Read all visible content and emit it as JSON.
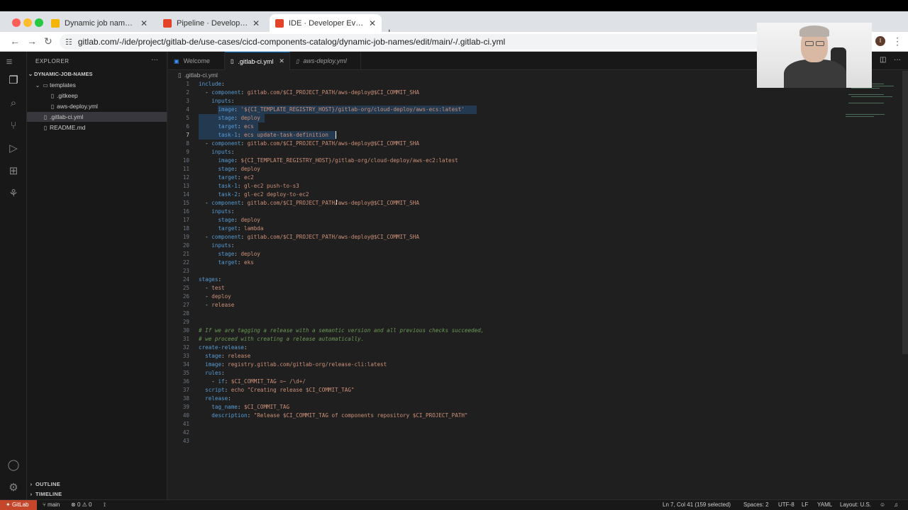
{
  "browser": {
    "tabs": [
      {
        "title": "Dynamic job names - Google",
        "active": false,
        "favicon_color": "#f4b400"
      },
      {
        "title": "Pipeline · Developer Evangeli",
        "active": false,
        "favicon_color": "#e24329"
      },
      {
        "title": "IDE · Developer Evangelism a",
        "active": true,
        "favicon_color": "#e24329"
      }
    ],
    "new_tab": "+",
    "url": "gitlab.com/-/ide/project/gitlab-de/use-cases/cicd-components-catalog/dynamic-job-names/edit/main/-/.gitlab-ci.yml",
    "profile_initial": "I"
  },
  "sidebar": {
    "header": "EXPLORER",
    "root": "DYNAMIC-JOB-NAMES",
    "items": [
      {
        "label": "templates",
        "type": "folder"
      },
      {
        "label": ".gitkeep",
        "type": "file"
      },
      {
        "label": "aws-deploy.yml",
        "type": "file"
      },
      {
        "label": ".gitlab-ci.yml",
        "type": "file"
      },
      {
        "label": "README.md",
        "type": "file"
      }
    ],
    "outline": "OUTLINE",
    "timeline": "TIMELINE"
  },
  "editor": {
    "tabs": [
      {
        "label": "Welcome",
        "active": false
      },
      {
        "label": ".gitlab-ci.yml",
        "active": true
      },
      {
        "label": "aws-deploy.yml",
        "active": false
      }
    ],
    "breadcrumb": ".gitlab-ci.yml",
    "current_line": 7,
    "lines": [
      "include:",
      "  - component: gitlab.com/$CI_PROJECT_PATH/aws-deploy@$CI_COMMIT_SHA",
      "    inputs:",
      "      image: '${CI_TEMPLATE_REGISTRY_HOST}/gitlab-org/cloud-deploy/aws-ecs:latest'",
      "      stage: deploy",
      "      target: ecs",
      "      task-1: ecs update-task-definition",
      "  - component: gitlab.com/$CI_PROJECT_PATH/aws-deploy@$CI_COMMIT_SHA",
      "    inputs:",
      "      image: ${CI_TEMPLATE_REGISTRY_HOST}/gitlab-org/cloud-deploy/aws-ec2:latest",
      "      stage: deploy",
      "      target: ec2",
      "      task-1: gl-ec2 push-to-s3",
      "      task-2: gl-ec2 deploy-to-ec2",
      "  - component: gitlab.com/$CI_PROJECT_PATH/aws-deploy@$CI_COMMIT_SHA",
      "    inputs:",
      "      stage: deploy",
      "      target: lambda",
      "  - component: gitlab.com/$CI_PROJECT_PATH/aws-deploy@$CI_COMMIT_SHA",
      "    inputs:",
      "      stage: deploy",
      "      target: eks",
      "",
      "stages:",
      "  - test",
      "  - deploy",
      "  - release",
      "",
      "",
      "# If we are tagging a release with a semantic version and all previous checks succeeded,",
      "# we proceed with creating a release automatically.",
      "create-release:",
      "  stage: release",
      "  image: registry.gitlab.com/gitlab-org/release-cli:latest",
      "  rules:",
      "    - if: $CI_COMMIT_TAG =~ /\\d+/",
      "  script: echo \"Creating release $CI_COMMIT_TAG\"",
      "  release:",
      "    tag_name: $CI_COMMIT_TAG",
      "    description: \"Release $CI_COMMIT_TAG of components repository $CI_PROJECT_PATH\"",
      "",
      "",
      ""
    ]
  },
  "statusbar": {
    "remote": "GitLab",
    "branch": "main",
    "problems": "0",
    "warnings": "0",
    "position": "Ln 7, Col 41 (159 selected)",
    "spaces": "Spaces: 2",
    "encoding": "UTF-8",
    "eol": "LF",
    "language": "YAML",
    "layout": "Layout: U.S."
  },
  "colors": {
    "key": "#569cd6",
    "string": "#ce9178",
    "comment": "#6a9955",
    "remote_badge": "#c4462b"
  }
}
